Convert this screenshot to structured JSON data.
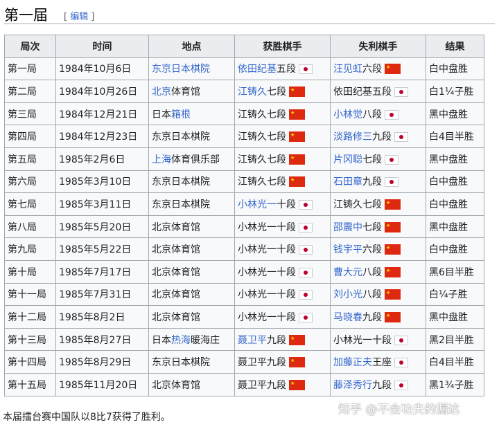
{
  "section": {
    "title": "第一届",
    "edit_open": "[ ",
    "edit_label": "编辑",
    "edit_close": " ]"
  },
  "table": {
    "headers": [
      "局次",
      "时间",
      "地点",
      "获胜棋手",
      "失利棋手",
      "结果"
    ],
    "rows": [
      {
        "round": "第一局",
        "date": "1984年10月6日",
        "venue": [
          {
            "t": "东京日本棋院",
            "link": true
          }
        ],
        "winner": [
          {
            "t": "依田纪基",
            "link": true
          },
          {
            "t": "五段",
            "link": false
          }
        ],
        "winner_flag": "jp-flag",
        "loser": [
          {
            "t": "汪见虹",
            "link": true
          },
          {
            "t": "六段",
            "link": false
          }
        ],
        "loser_flag": "cn-flag",
        "result": "白中盘胜"
      },
      {
        "round": "第二局",
        "date": "1984年10月26日",
        "venue": [
          {
            "t": "北京",
            "link": true
          },
          {
            "t": "体育馆",
            "link": false
          }
        ],
        "winner": [
          {
            "t": "江铸久",
            "link": true
          },
          {
            "t": "七段",
            "link": false
          }
        ],
        "winner_flag": "cn-flag",
        "loser": [
          {
            "t": "依田纪基五段",
            "link": false
          }
        ],
        "loser_flag": "jp-flag",
        "result": "白1¼子胜"
      },
      {
        "round": "第三局",
        "date": "1984年12月21日",
        "venue": [
          {
            "t": "日本",
            "link": false
          },
          {
            "t": "箱根",
            "link": true
          }
        ],
        "winner": [
          {
            "t": "江铸久七段",
            "link": false
          }
        ],
        "winner_flag": "cn-flag",
        "loser": [
          {
            "t": "小林觉",
            "link": true
          },
          {
            "t": "八段",
            "link": false
          }
        ],
        "loser_flag": "jp-flag",
        "result": "黑中盘胜"
      },
      {
        "round": "第四局",
        "date": "1984年12月23日",
        "venue": [
          {
            "t": "东京日本棋院",
            "link": false
          }
        ],
        "winner": [
          {
            "t": "江铸久七段",
            "link": false
          }
        ],
        "winner_flag": "cn-flag",
        "loser": [
          {
            "t": "淡路修三",
            "link": true
          },
          {
            "t": "九段",
            "link": false
          }
        ],
        "loser_flag": "jp-flag",
        "result": "白4目半胜"
      },
      {
        "round": "第五局",
        "date": "1985年2月6日",
        "venue": [
          {
            "t": "上海",
            "link": true
          },
          {
            "t": "体育俱乐部",
            "link": false
          }
        ],
        "winner": [
          {
            "t": "江铸久七段",
            "link": false
          }
        ],
        "winner_flag": "cn-flag",
        "loser": [
          {
            "t": "片冈聪",
            "link": true
          },
          {
            "t": "七段",
            "link": false
          }
        ],
        "loser_flag": "jp-flag",
        "result": "黑中盘胜"
      },
      {
        "round": "第六局",
        "date": "1985年3月10日",
        "venue": [
          {
            "t": "东京日本棋院",
            "link": false
          }
        ],
        "winner": [
          {
            "t": "江铸久七段",
            "link": false
          }
        ],
        "winner_flag": "cn-flag",
        "loser": [
          {
            "t": "石田章",
            "link": true
          },
          {
            "t": "九段",
            "link": false
          }
        ],
        "loser_flag": "jp-flag",
        "result": "白中盘胜"
      },
      {
        "round": "第七局",
        "date": "1985年3月11日",
        "venue": [
          {
            "t": "东京日本棋院",
            "link": false
          }
        ],
        "winner": [
          {
            "t": "小林光一",
            "link": true
          },
          {
            "t": "十段",
            "link": false
          }
        ],
        "winner_flag": "jp-flag",
        "loser": [
          {
            "t": "江铸久七段",
            "link": false
          }
        ],
        "loser_flag": "cn-flag",
        "result": "白中盘胜"
      },
      {
        "round": "第八局",
        "date": "1985年5月20日",
        "venue": [
          {
            "t": "北京体育馆",
            "link": false
          }
        ],
        "winner": [
          {
            "t": "小林光一十段",
            "link": false
          }
        ],
        "winner_flag": "jp-flag",
        "loser": [
          {
            "t": "邵震中",
            "link": true
          },
          {
            "t": "七段",
            "link": false
          }
        ],
        "loser_flag": "cn-flag",
        "result": "黑中盘胜"
      },
      {
        "round": "第九局",
        "date": "1985年5月22日",
        "venue": [
          {
            "t": "北京体育馆",
            "link": false
          }
        ],
        "winner": [
          {
            "t": "小林光一十段",
            "link": false
          }
        ],
        "winner_flag": "jp-flag",
        "loser": [
          {
            "t": "钱宇平",
            "link": true
          },
          {
            "t": "六段",
            "link": false
          }
        ],
        "loser_flag": "cn-flag",
        "result": "白中盘胜"
      },
      {
        "round": "第十局",
        "date": "1985年7月17日",
        "venue": [
          {
            "t": "北京体育馆",
            "link": false
          }
        ],
        "winner": [
          {
            "t": "小林光一十段",
            "link": false
          }
        ],
        "winner_flag": "jp-flag",
        "loser": [
          {
            "t": "曹大元",
            "link": true
          },
          {
            "t": "八段",
            "link": false
          }
        ],
        "loser_flag": "cn-flag",
        "result": "黑6目半胜"
      },
      {
        "round": "第十一局",
        "date": "1985年7月31日",
        "venue": [
          {
            "t": "北京体育馆",
            "link": false
          }
        ],
        "winner": [
          {
            "t": "小林光一十段",
            "link": false
          }
        ],
        "winner_flag": "jp-flag",
        "loser": [
          {
            "t": "刘小光",
            "link": true
          },
          {
            "t": "八段",
            "link": false
          }
        ],
        "loser_flag": "cn-flag",
        "result": "白¼子胜"
      },
      {
        "round": "第十二局",
        "date": "1985年8月2日",
        "venue": [
          {
            "t": "北京体育馆",
            "link": false
          }
        ],
        "winner": [
          {
            "t": "小林光一十段",
            "link": false
          }
        ],
        "winner_flag": "jp-flag",
        "loser": [
          {
            "t": "马晓春",
            "link": true
          },
          {
            "t": "九段",
            "link": false
          }
        ],
        "loser_flag": "cn-flag",
        "result": "黑中盘胜"
      },
      {
        "round": "第十三局",
        "date": "1985年8月27日",
        "venue": [
          {
            "t": "日本",
            "link": false
          },
          {
            "t": "热海",
            "link": true
          },
          {
            "t": "暖海庄",
            "link": false
          }
        ],
        "winner": [
          {
            "t": "聂卫平",
            "link": true
          },
          {
            "t": "九段",
            "link": false
          }
        ],
        "winner_flag": "cn-flag",
        "loser": [
          {
            "t": "小林光一十段",
            "link": false
          }
        ],
        "loser_flag": "jp-flag",
        "result": "黑2目半胜"
      },
      {
        "round": "第十四局",
        "date": "1985年8月29日",
        "venue": [
          {
            "t": "东京日本棋院",
            "link": false
          }
        ],
        "winner": [
          {
            "t": "聂卫平九段",
            "link": false
          }
        ],
        "winner_flag": "cn-flag",
        "loser": [
          {
            "t": "加藤正夫",
            "link": true
          },
          {
            "t": "王座",
            "link": false
          }
        ],
        "loser_flag": "jp-flag",
        "result": "白4目半胜"
      },
      {
        "round": "第十五局",
        "date": "1985年11月20日",
        "venue": [
          {
            "t": "北京体育馆",
            "link": false
          }
        ],
        "winner": [
          {
            "t": "聂卫平九段",
            "link": false
          }
        ],
        "winner_flag": "cn-flag",
        "loser": [
          {
            "t": "藤泽秀行",
            "link": true
          },
          {
            "t": "九段",
            "link": false
          }
        ],
        "loser_flag": "jp-flag",
        "result": "黑1¾子胜"
      }
    ]
  },
  "footer": {
    "text": "本届擂台赛中国队以8比7获得了胜利。"
  },
  "watermark": {
    "text": "知乎 @不会功夫的漏达"
  },
  "colors": {
    "link": "#3366cc",
    "header_bg": "#eaecf0",
    "cell_bg": "#f8f9fa",
    "border": "#a2a9b1"
  }
}
